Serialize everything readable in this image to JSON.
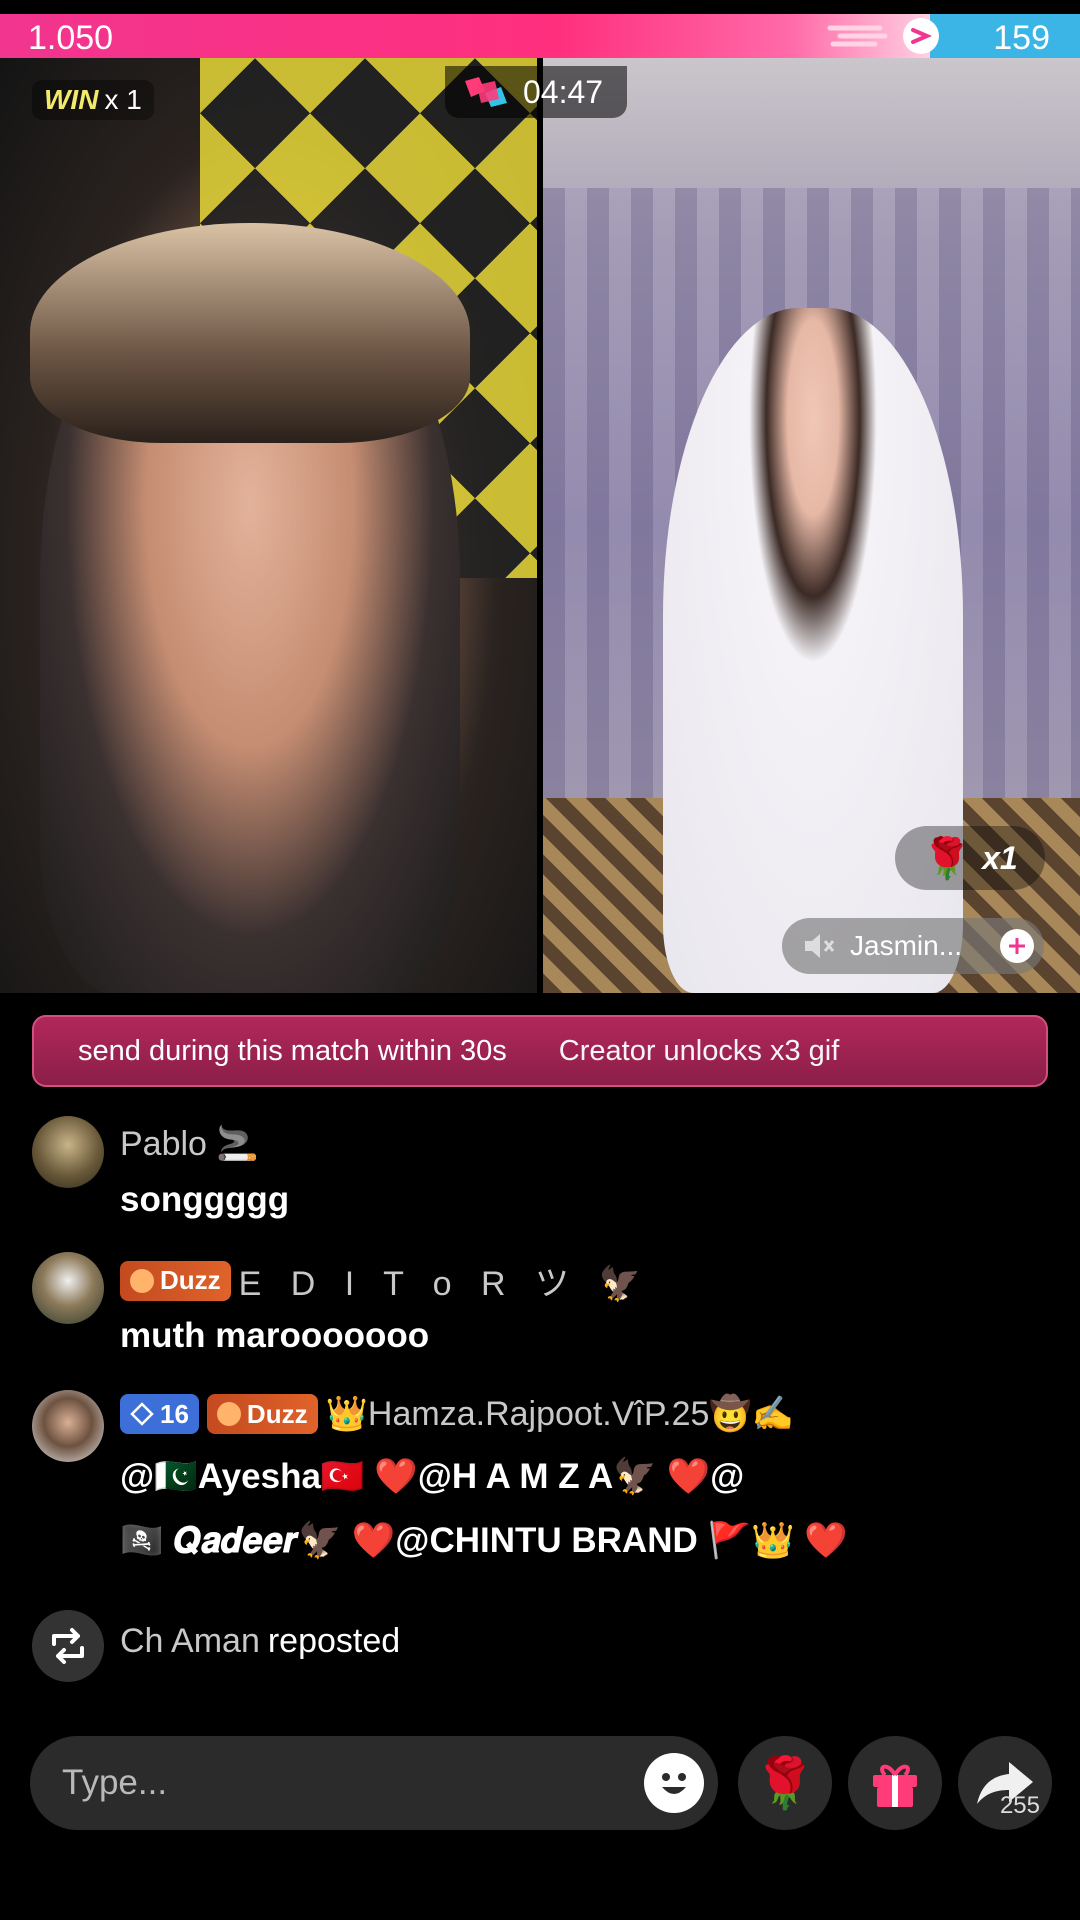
{
  "battle": {
    "left_score": "1.050",
    "right_score": "159",
    "win_label": "WIN",
    "win_count": "x 1",
    "timer": "04:47",
    "colors": {
      "left": "#f2358f",
      "right": "#3bb5e6"
    }
  },
  "right_stream": {
    "rose_multiplier": "x1",
    "host_name": "Jasmin..."
  },
  "banner": {
    "text": "send during this match within 30s",
    "text2": "Creator unlocks x3 gif"
  },
  "chat": [
    {
      "username": "Pablo 🚬",
      "text": "songgggg"
    },
    {
      "badge_fan": "Duzz",
      "username": "E D I T o R ツ 🦅",
      "text": "muth marooooooo"
    },
    {
      "badge_level": "16",
      "badge_fan": "Duzz",
      "username": "👑Hamza.Rajpoot.VîP.25🤠✍️",
      "line1": "@🇵🇰Ayesha🇹🇷 ❤️@H A M Z A🦅 ❤️@",
      "line2": "🏴‍☠️ 𝑸𝒂𝒅𝒆𝒆𝒓🦅 ❤️@CHINTU BRAND 🚩👑 ❤️"
    }
  ],
  "repost": {
    "user": "Ch Aman",
    "action": "reposted"
  },
  "composer": {
    "placeholder": "Type...",
    "share_count": "255"
  }
}
